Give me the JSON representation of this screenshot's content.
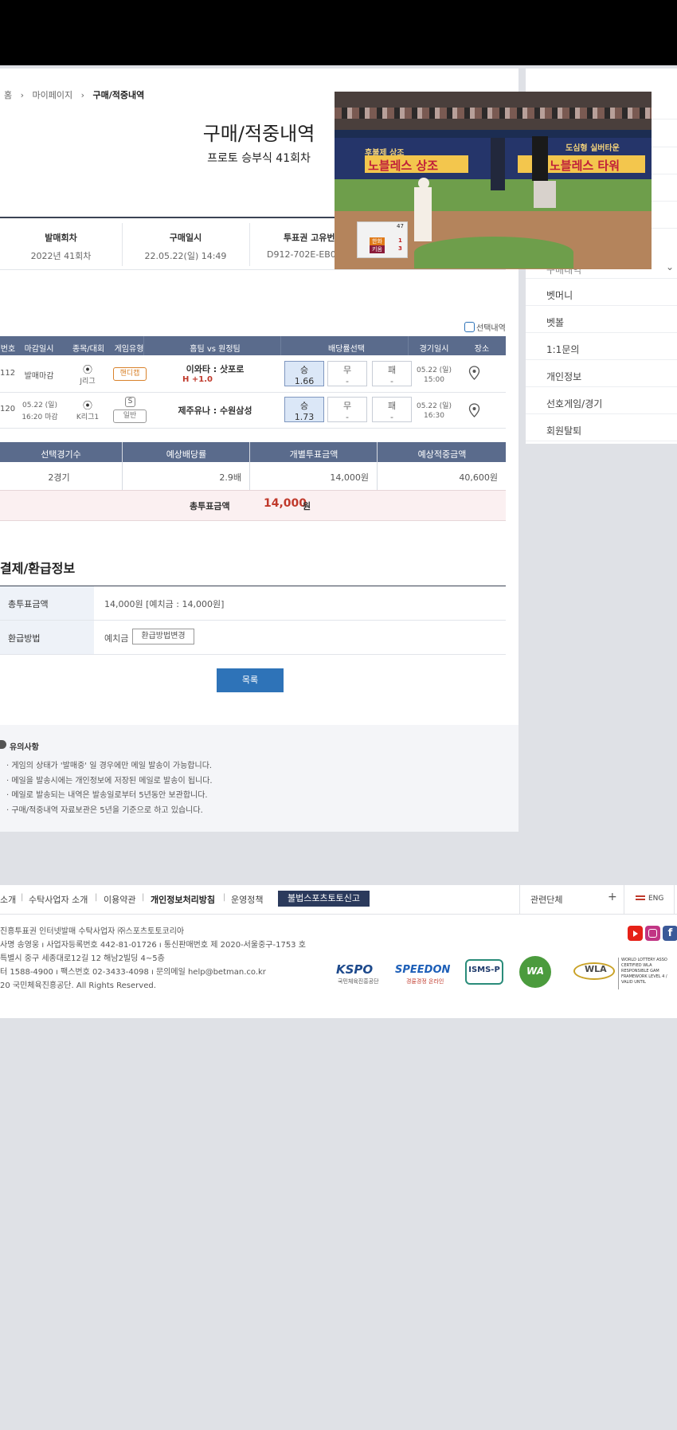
{
  "breadcrumb": {
    "home": "홈",
    "sep1": "›",
    "mypage": "마이페이지",
    "sep2": "›",
    "current": "구매/적중내역"
  },
  "page": {
    "title": "구매/적중내역",
    "subtitle": "프로토 승부식 41회차"
  },
  "summary": {
    "h1": "발매회차",
    "v1": "2022년 41회차",
    "h2": "구매일시",
    "v2": "22.05.22(일) 14:49",
    "h3": "투표권 고유번",
    "v3": "D912-702E-EB01"
  },
  "selected_toggle": "선택내역",
  "games_table": {
    "headers": [
      "번호",
      "마감일시",
      "종목/대회",
      "게임유형",
      "홈팀 vs 원정팀",
      "배당률선택",
      "경기일시",
      "장소"
    ],
    "rows": [
      {
        "no": "112",
        "deadline": "발매마감",
        "league": "J리그",
        "type_badge": "핸디캡",
        "home_away": "이와타 : 삿포로",
        "handicap": "H +1.0",
        "win_label": "승",
        "win_odds": "1.66",
        "draw_label": "무",
        "draw_odds": "-",
        "lose_label": "패",
        "lose_odds": "-",
        "date1": "05.22 (일)",
        "date2": "15:00"
      },
      {
        "no": "120",
        "deadline1": "05.22 (일)",
        "deadline2": "16:20 마감",
        "league": "K리그1",
        "type_icon": "S",
        "type_badge": "일반",
        "home_away": "제주유나 : 수원삼성",
        "win_label": "승",
        "win_odds": "1.73",
        "draw_label": "무",
        "draw_odds": "-",
        "lose_label": "패",
        "lose_odds": "-",
        "date1": "05.22 (일)",
        "date2": "16:30"
      }
    ]
  },
  "totals_table": {
    "headers": [
      "선택경기수",
      "예상배당률",
      "개별투표금액",
      "예상적중금액"
    ],
    "values": [
      "2경기",
      "2.9배",
      "14,000원",
      "40,600원"
    ],
    "total_label": "총투표금액",
    "total_value": "14,000",
    "total_unit": "원"
  },
  "payment": {
    "title": "결제/환급정보",
    "row1_label": "총투표금액",
    "row1_value": "14,000원 [예치금 : 14,000원]",
    "row2_label": "환급방법",
    "row2_value": "예치금",
    "change_button": "환급방법변경"
  },
  "list_button": "목록",
  "notice": {
    "title": "유의사항",
    "items": [
      "게임의 상태가 '발매중' 일 경우에만 메일 발송이 가능합니다.",
      "메일을 발송시에는 개인정보에 저장된 메일로 발송이 됩니다.",
      "메일로 발송되는 내역은 발송일로부터 5년동안 보관합니다.",
      "구매/적중내역 자료보관은 5년을 기준으로 하고 있습니다."
    ]
  },
  "sidebar": {
    "collapsed_label": "구매내역",
    "items": [
      "벳머니",
      "벳볼",
      "1:1문의",
      "개인정보",
      "선호게임/경기",
      "회원탈퇴"
    ]
  },
  "video": {
    "banner_left": "후불제 상조",
    "banner_big": "노블레스 상조",
    "banner_right_small": "도심형 실버타운",
    "banner_right_big": "노블레스 타워",
    "score_team1": "한화",
    "score1": "1",
    "score_team2": "키움",
    "score2": "3",
    "pitch_count": "47"
  },
  "footer": {
    "links": [
      "소개",
      "수탁사업자 소개",
      "이용약관",
      "개인정보처리방침",
      "운영정책"
    ],
    "report_button": "불법스포츠토토신고",
    "related_label": "관련단체",
    "related_plus": "+",
    "lang": "ENG",
    "info": [
      "진흥투표권 인터넷발매 수탁사업자 ㈜스포츠토토코리아",
      "사명 송영웅  ı  사업자등록번호 442-81-01726  ı  통신판매번호 제 2020-서울중구-1753 호",
      "특별시 중구 세종대로12길 12 해남2빌딩 4~5층",
      "터 1588-4900  ı  팩스번호 02-3433-4098  ı  문의메일 help@betman.co.kr",
      "20 국민체육진흥공단. All Rights Reserved."
    ],
    "logos": {
      "kspo": "KSPO",
      "kspo_sub": "국민체육진흥공단",
      "speedon": "SPEEDON",
      "speedon_sub": "경륜경정 온라인",
      "isms": "ISMS-P",
      "wa": "WA",
      "wla": "WLA",
      "wla_text": "WORLD LOTTERY ASSO CERTIFIED WLA RESPONSIBLE GAM FRAMEWORK LEVEL 4 / VALID UNTIL"
    }
  },
  "colors": {
    "header_blue": "#5a6b8c",
    "accent_red": "#c0392b",
    "button_blue": "#2e73b8",
    "total_bg": "#fbf0f1"
  }
}
